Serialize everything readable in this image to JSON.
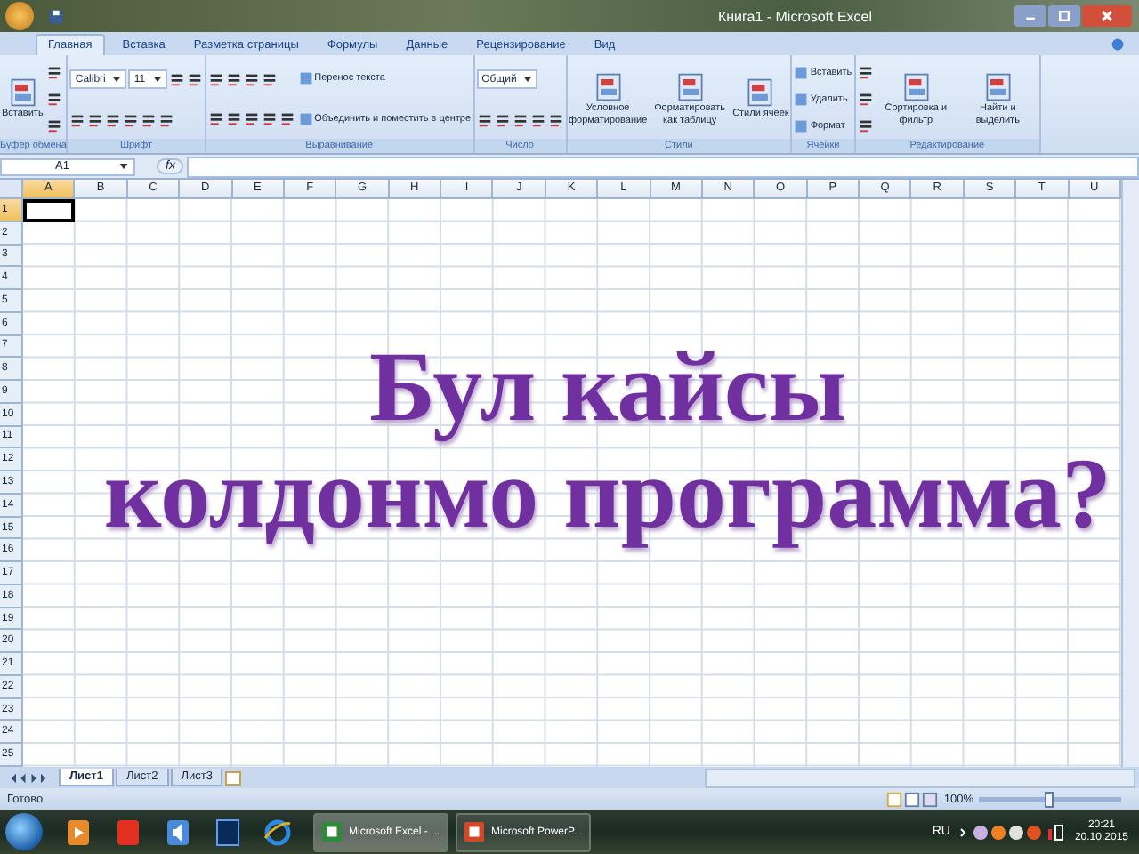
{
  "window": {
    "title": "Книга1 - Microsoft Excel"
  },
  "tabs": [
    {
      "label": "Главная",
      "selected": true
    },
    {
      "label": "Вставка",
      "selected": false
    },
    {
      "label": "Разметка страницы",
      "selected": false
    },
    {
      "label": "Формулы",
      "selected": false
    },
    {
      "label": "Данные",
      "selected": false
    },
    {
      "label": "Рецензирование",
      "selected": false
    },
    {
      "label": "Вид",
      "selected": false
    }
  ],
  "ribbon": {
    "groups": [
      {
        "title": "Буфер обмена",
        "columns": [
          [
            [
              {
                "kind": "large",
                "label": "Вставить"
              }
            ]
          ],
          [
            [
              {
                "kind": "icon"
              }
            ],
            [
              {
                "kind": "icon"
              }
            ],
            [
              {
                "kind": "icon"
              }
            ]
          ]
        ]
      },
      {
        "title": "Шрифт",
        "columns": [
          [
            [
              {
                "kind": "field",
                "value": "Calibri"
              },
              {
                "kind": "field",
                "value": "11"
              },
              {
                "kind": "icon"
              },
              {
                "kind": "icon"
              }
            ],
            [
              {
                "kind": "icon"
              },
              {
                "kind": "icon"
              },
              {
                "kind": "icon"
              },
              {
                "kind": "icon"
              },
              {
                "kind": "icon"
              },
              {
                "kind": "icon"
              }
            ]
          ]
        ]
      },
      {
        "title": "Выравнивание",
        "columns": [
          [
            [
              {
                "kind": "icon"
              },
              {
                "kind": "icon"
              },
              {
                "kind": "icon"
              },
              {
                "kind": "icon"
              }
            ],
            [
              {
                "kind": "icon"
              },
              {
                "kind": "icon"
              },
              {
                "kind": "icon"
              },
              {
                "kind": "icon"
              },
              {
                "kind": "icon"
              }
            ]
          ],
          [
            [
              {
                "kind": "small",
                "label": "Перенос текста"
              }
            ],
            [
              {
                "kind": "small",
                "label": "Объединить и поместить в центре"
              }
            ]
          ]
        ]
      },
      {
        "title": "Число",
        "columns": [
          [
            [
              {
                "kind": "field",
                "value": "Общий"
              }
            ],
            [
              {
                "kind": "icon"
              },
              {
                "kind": "icon"
              },
              {
                "kind": "icon"
              },
              {
                "kind": "icon"
              },
              {
                "kind": "icon"
              }
            ]
          ]
        ]
      },
      {
        "title": "Стили",
        "columns": [
          [
            [
              {
                "kind": "large",
                "label": "Условное форматирование"
              }
            ]
          ],
          [
            [
              {
                "kind": "large",
                "label": "Форматировать как таблицу"
              }
            ]
          ],
          [
            [
              {
                "kind": "large",
                "label": "Стили ячеек"
              }
            ]
          ]
        ]
      },
      {
        "title": "Ячейки",
        "columns": [
          [
            [
              {
                "kind": "small",
                "label": "Вставить"
              }
            ],
            [
              {
                "kind": "small",
                "label": "Удалить"
              }
            ],
            [
              {
                "kind": "small",
                "label": "Формат"
              }
            ]
          ]
        ]
      },
      {
        "title": "Редактирование",
        "columns": [
          [
            [
              {
                "kind": "icon"
              }
            ],
            [
              {
                "kind": "icon"
              }
            ],
            [
              {
                "kind": "icon"
              }
            ]
          ],
          [
            [
              {
                "kind": "large",
                "label": "Сортировка и фильтр"
              }
            ]
          ],
          [
            [
              {
                "kind": "large",
                "label": "Найти и выделить"
              }
            ]
          ]
        ]
      }
    ]
  },
  "formula_bar": {
    "name_box": "A1",
    "fx": "fx"
  },
  "columns": [
    {
      "label": "A",
      "selected": true
    },
    {
      "label": "B",
      "selected": false
    },
    {
      "label": "C",
      "selected": false
    },
    {
      "label": "D",
      "selected": false
    },
    {
      "label": "E",
      "selected": false
    },
    {
      "label": "F",
      "selected": false
    },
    {
      "label": "G",
      "selected": false
    },
    {
      "label": "H",
      "selected": false
    },
    {
      "label": "I",
      "selected": false
    },
    {
      "label": "J",
      "selected": false
    },
    {
      "label": "K",
      "selected": false
    },
    {
      "label": "L",
      "selected": false
    },
    {
      "label": "M",
      "selected": false
    },
    {
      "label": "N",
      "selected": false
    },
    {
      "label": "O",
      "selected": false
    },
    {
      "label": "P",
      "selected": false
    },
    {
      "label": "Q",
      "selected": false
    },
    {
      "label": "R",
      "selected": false
    },
    {
      "label": "S",
      "selected": false
    },
    {
      "label": "T",
      "selected": false
    },
    {
      "label": "U",
      "selected": false
    }
  ],
  "rows": [
    {
      "label": "1",
      "selected": true
    },
    {
      "label": "2",
      "selected": false
    },
    {
      "label": "3",
      "selected": false
    },
    {
      "label": "4",
      "selected": false
    },
    {
      "label": "5",
      "selected": false
    },
    {
      "label": "6",
      "selected": false
    },
    {
      "label": "7",
      "selected": false
    },
    {
      "label": "8",
      "selected": false
    },
    {
      "label": "9",
      "selected": false
    },
    {
      "label": "10",
      "selected": false
    },
    {
      "label": "11",
      "selected": false
    },
    {
      "label": "12",
      "selected": false
    },
    {
      "label": "13",
      "selected": false
    },
    {
      "label": "14",
      "selected": false
    },
    {
      "label": "15",
      "selected": false
    },
    {
      "label": "16",
      "selected": false
    },
    {
      "label": "17",
      "selected": false
    },
    {
      "label": "18",
      "selected": false
    },
    {
      "label": "19",
      "selected": false
    },
    {
      "label": "20",
      "selected": false
    },
    {
      "label": "21",
      "selected": false
    },
    {
      "label": "22",
      "selected": false
    },
    {
      "label": "23",
      "selected": false
    },
    {
      "label": "24",
      "selected": false
    },
    {
      "label": "25",
      "selected": false
    }
  ],
  "overlay": {
    "lines": [
      "Бул кайсы",
      "колдонмо программа?"
    ]
  },
  "sheets": [
    {
      "label": "Лист1",
      "selected": true
    },
    {
      "label": "Лист2",
      "selected": false
    },
    {
      "label": "Лист3",
      "selected": false
    }
  ],
  "status_bar": {
    "status": "Готово",
    "zoom": "100%",
    "zoom_level": {
      "level": 0.5
    }
  },
  "taskbar": {
    "windows": [
      {
        "label": "Microsoft Excel - ...",
        "kind": "excel",
        "selected": true
      },
      {
        "label": "Microsoft PowerP...",
        "kind": "powerpoint",
        "selected": false
      }
    ],
    "language": "RU",
    "time": "20:21",
    "date": "20.10.2015"
  }
}
